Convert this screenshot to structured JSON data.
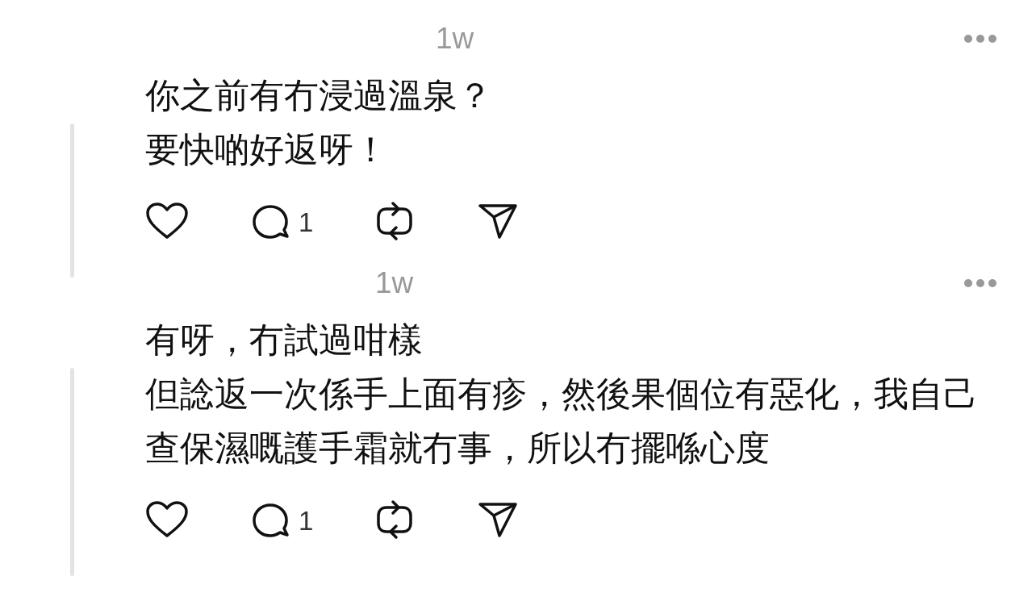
{
  "posts": [
    {
      "time": "1w",
      "paragraphs": [
        "你之前有冇浸過溫泉？",
        "要快啲好返呀！"
      ],
      "reply_count": "1"
    },
    {
      "time": "1w",
      "paragraphs": [
        "有呀，冇試過咁樣",
        "但諗返一次係手上面有疹，然後果個位有惡化，我自己查保濕嘅護手霜就冇事，所以冇擺喺心度"
      ],
      "reply_count": "1"
    }
  ]
}
